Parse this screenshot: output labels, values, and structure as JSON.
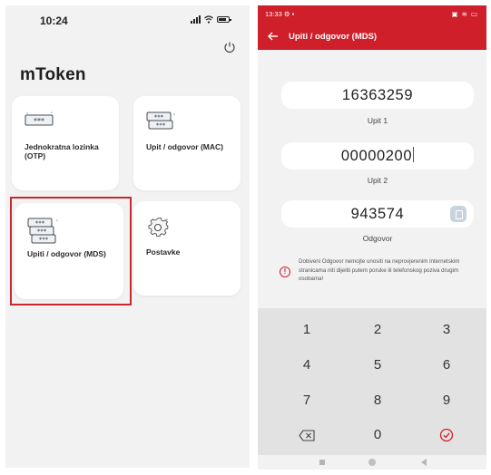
{
  "left_screen": {
    "status_time": "10:24",
    "app_title": "mToken",
    "tiles": [
      {
        "label": "Jednokratna lozinka (OTP)"
      },
      {
        "label": "Upit / odgovor (MAC)"
      },
      {
        "label": "Upiti / odgovor (MDS)"
      },
      {
        "label": "Postavke"
      }
    ],
    "highlight_color": "#c8282e"
  },
  "right_screen": {
    "status_time": "13:33",
    "header_title": "Upiti / odgovor (MDS)",
    "accent_color": "#cf1f2a",
    "fields": [
      {
        "value": "16363259",
        "label": "Upit 1"
      },
      {
        "value": "00000200",
        "label": "Upit 2"
      },
      {
        "value": "943574",
        "label": "Odgovor"
      }
    ],
    "warning": "Dobiveni Odgovor nemojte unositi na neprovjerenim internetskim stranicama niti dijeliti putem poruke ili telefonskog poziva drugim osobama!",
    "keypad": [
      "1",
      "2",
      "3",
      "4",
      "5",
      "6",
      "7",
      "8",
      "9",
      "0"
    ],
    "icons": {
      "back": "arrow-left-icon",
      "copy": "copy-icon",
      "warning": "info-circle-icon",
      "backspace": "backspace-icon",
      "confirm": "check-circle-icon"
    }
  }
}
